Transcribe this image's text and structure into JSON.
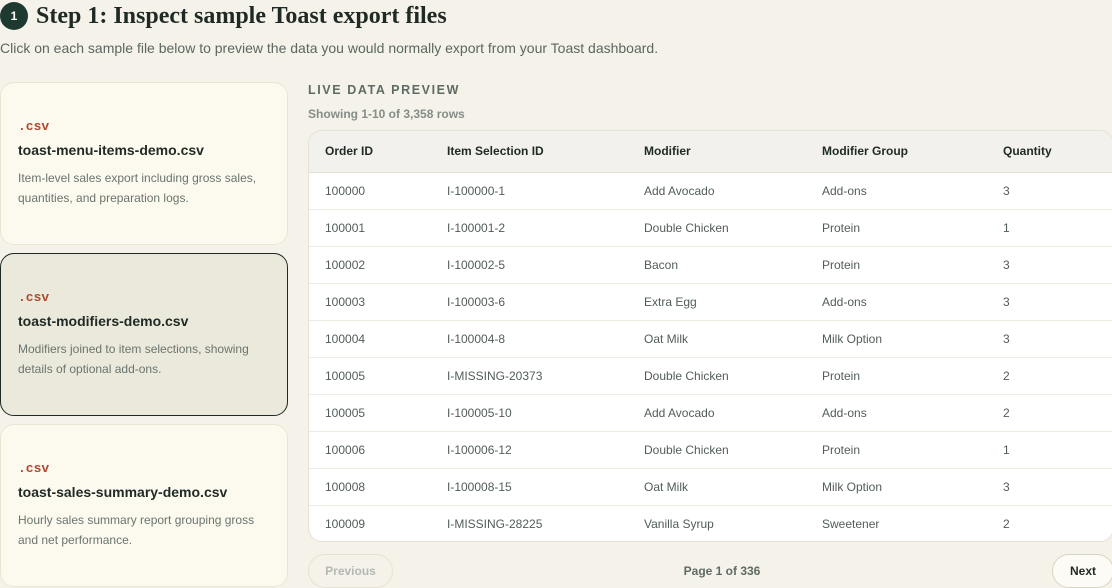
{
  "header": {
    "step_number": "1",
    "title": "Step 1: Inspect sample Toast export files",
    "subtitle": "Click on each sample file below to preview the data you would normally export from your Toast dashboard."
  },
  "files": [
    {
      "ext": ".csv",
      "name": "toast-menu-items-demo.csv",
      "description": "Item-level sales export including gross sales, quantities, and preparation logs.",
      "selected": false
    },
    {
      "ext": ".csv",
      "name": "toast-modifiers-demo.csv",
      "description": "Modifiers joined to item selections, showing details of optional add-ons.",
      "selected": true
    },
    {
      "ext": ".csv",
      "name": "toast-sales-summary-demo.csv",
      "description": "Hourly sales summary report grouping gross and net performance.",
      "selected": false
    }
  ],
  "preview": {
    "label": "LIVE DATA PREVIEW",
    "rows_info": "Showing 1-10 of 3,358 rows",
    "columns": [
      "Order ID",
      "Item Selection ID",
      "Modifier",
      "Modifier Group",
      "Quantity"
    ],
    "rows": [
      [
        "100000",
        "I-100000-1",
        "Add Avocado",
        "Add-ons",
        "3"
      ],
      [
        "100001",
        "I-100001-2",
        "Double Chicken",
        "Protein",
        "1"
      ],
      [
        "100002",
        "I-100002-5",
        "Bacon",
        "Protein",
        "3"
      ],
      [
        "100003",
        "I-100003-6",
        "Extra Egg",
        "Add-ons",
        "3"
      ],
      [
        "100004",
        "I-100004-8",
        "Oat Milk",
        "Milk Option",
        "3"
      ],
      [
        "100005",
        "I-MISSING-20373",
        "Double Chicken",
        "Protein",
        "2"
      ],
      [
        "100005",
        "I-100005-10",
        "Add Avocado",
        "Add-ons",
        "2"
      ],
      [
        "100006",
        "I-100006-12",
        "Double Chicken",
        "Protein",
        "1"
      ],
      [
        "100008",
        "I-100008-15",
        "Oat Milk",
        "Milk Option",
        "3"
      ],
      [
        "100009",
        "I-MISSING-28225",
        "Vanilla Syrup",
        "Sweetener",
        "2"
      ]
    ]
  },
  "pagination": {
    "previous_label": "Previous",
    "page_text": "Page 1 of 336",
    "next_label": "Next"
  },
  "colors": {
    "background": "#f5f2ea",
    "accent": "#1e3a30",
    "file_ext": "#b0472e"
  }
}
